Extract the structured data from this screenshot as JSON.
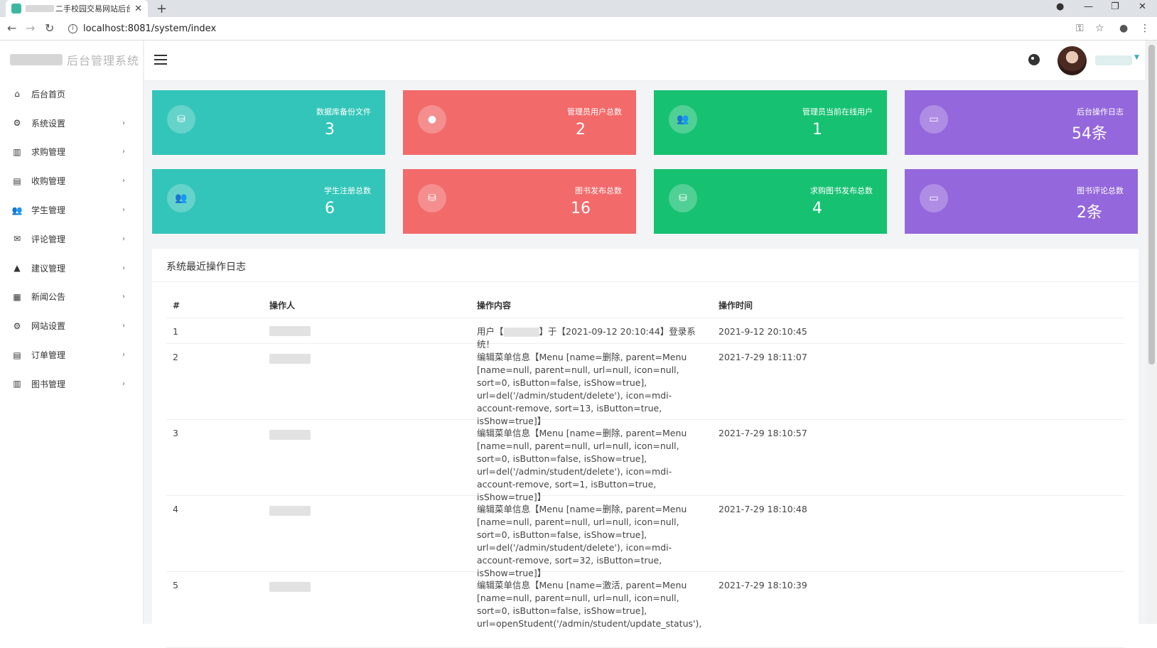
{
  "browser": {
    "tab_title": "二手校园交易网站后台",
    "tab_close": "✕",
    "new_tab": "+",
    "url": "localhost:8081/system/index",
    "window_controls": [
      "—",
      "❐",
      "✕"
    ]
  },
  "app": {
    "logo_text": "后台管理系统"
  },
  "sidebar": {
    "items": [
      {
        "label": "后台首页",
        "icon": "home-icon",
        "glyph": "⌂",
        "has_children": false
      },
      {
        "label": "系统设置",
        "icon": "gear-icon",
        "glyph": "⚙",
        "has_children": true
      },
      {
        "label": "求购管理",
        "icon": "book-icon",
        "glyph": "▥",
        "has_children": true
      },
      {
        "label": "收购管理",
        "icon": "book-open-icon",
        "glyph": "▤",
        "has_children": true
      },
      {
        "label": "学生管理",
        "icon": "users-icon",
        "glyph": "👥",
        "has_children": true
      },
      {
        "label": "评论管理",
        "icon": "comment-icon",
        "glyph": "✉",
        "has_children": true
      },
      {
        "label": "建议管理",
        "icon": "warning-icon",
        "glyph": "▲",
        "has_children": true
      },
      {
        "label": "新闻公告",
        "icon": "news-icon",
        "glyph": "▦",
        "has_children": true
      },
      {
        "label": "网站设置",
        "icon": "gear-icon",
        "glyph": "⚙",
        "has_children": true
      },
      {
        "label": "订单管理",
        "icon": "order-icon",
        "glyph": "▤",
        "has_children": true
      },
      {
        "label": "图书管理",
        "icon": "book-icon",
        "glyph": "▥",
        "has_children": true
      }
    ],
    "chevron": "›"
  },
  "stats": [
    {
      "label": "数据库备份文件",
      "value": "3",
      "color": "#33c5b9",
      "icon": "database-icon",
      "glyph": "⛁"
    },
    {
      "label": "管理员用户总数",
      "value": "2",
      "color": "#f26a6a",
      "icon": "user-icon",
      "glyph": "●"
    },
    {
      "label": "管理员当前在线用户",
      "value": "1",
      "color": "#17c172",
      "icon": "users-icon",
      "glyph": "👥"
    },
    {
      "label": "后台操作日志",
      "value": "54条",
      "color": "#9467dc",
      "icon": "monitor-icon",
      "glyph": "▭"
    },
    {
      "label": "学生注册总数",
      "value": "6",
      "color": "#33c5b9",
      "icon": "users-icon",
      "glyph": "👥"
    },
    {
      "label": "图书发布总数",
      "value": "16",
      "color": "#f26a6a",
      "icon": "database-icon",
      "glyph": "⛁"
    },
    {
      "label": "求购图书发布总数",
      "value": "4",
      "color": "#17c172",
      "icon": "database-icon",
      "glyph": "⛁"
    },
    {
      "label": "图书评论总数",
      "value": "2条",
      "color": "#9467dc",
      "icon": "chat-icon",
      "glyph": "▭"
    }
  ],
  "log_panel": {
    "title": "系统最近操作日志",
    "columns": [
      "#",
      "操作人",
      "操作内容",
      "操作时间"
    ],
    "rows": [
      {
        "no": "1",
        "content_pre": "用户【",
        "content_post": "】于【2021-09-12 20:10:44】登录系统！",
        "time": "2021-9-12 20:10:45"
      },
      {
        "no": "2",
        "content": "编辑菜单信息【Menu [name=删除, parent=Menu [name=null, parent=null, url=null, icon=null, sort=0, isButton=false, isShow=true], url=del('/admin/student/delete'), icon=mdi-account-remove, sort=13, isButton=true, isShow=true]】",
        "time": "2021-7-29 18:11:07"
      },
      {
        "no": "3",
        "content": "编辑菜单信息【Menu [name=删除, parent=Menu [name=null, parent=null, url=null, icon=null, sort=0, isButton=false, isShow=true], url=del('/admin/student/delete'), icon=mdi-account-remove, sort=1, isButton=true, isShow=true]】",
        "time": "2021-7-29 18:10:57"
      },
      {
        "no": "4",
        "content": "编辑菜单信息【Menu [name=删除, parent=Menu [name=null, parent=null, url=null, icon=null, sort=0, isButton=false, isShow=true], url=del('/admin/student/delete'), icon=mdi-account-remove, sort=32, isButton=true, isShow=true]】",
        "time": "2021-7-29 18:10:48"
      },
      {
        "no": "5",
        "content": "编辑菜单信息【Menu [name=激活, parent=Menu [name=null, parent=null, url=null, icon=null, sort=0, isButton=false, isShow=true], url=openStudent('/admin/student/update_status'),",
        "time": "2021-7-29 18:10:39"
      }
    ]
  }
}
